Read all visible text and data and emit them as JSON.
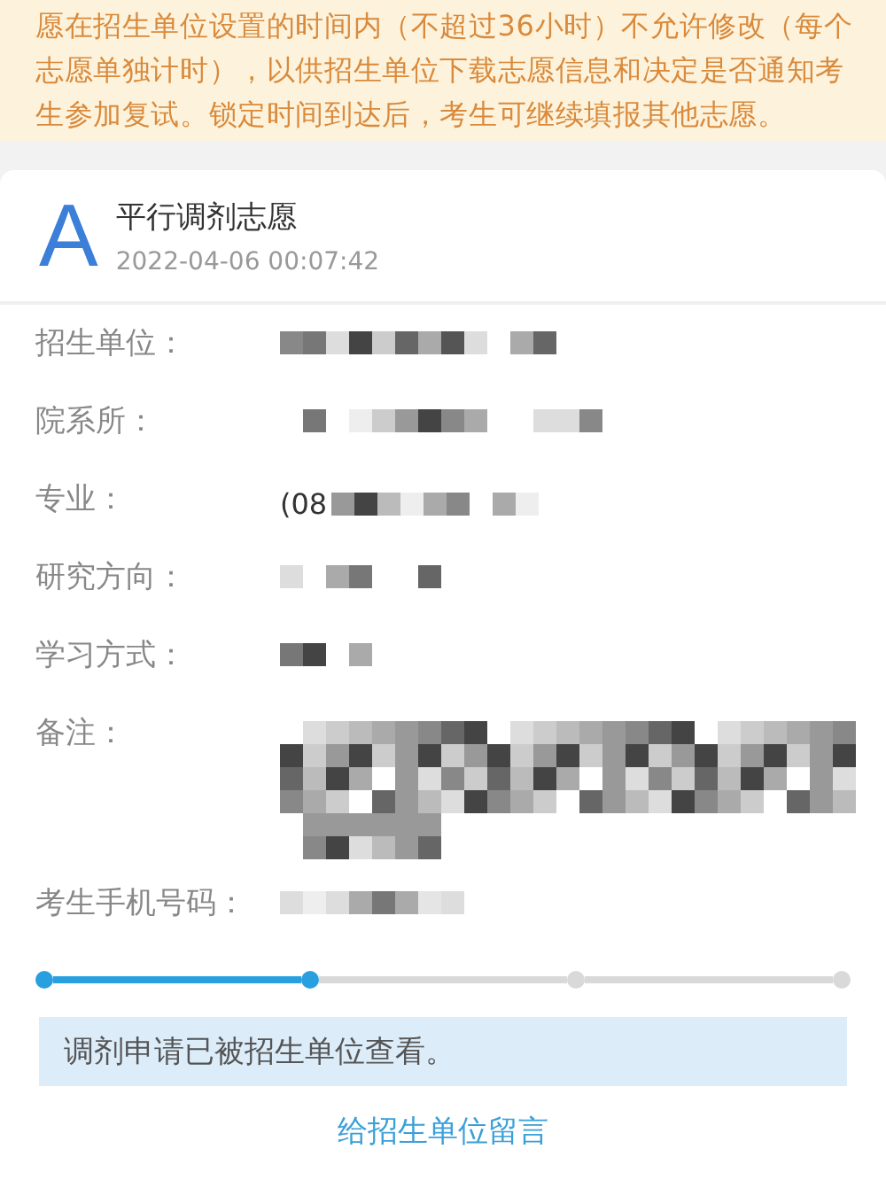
{
  "notice": {
    "lines": [
      "愿在招生单位设置的时间内（不超过36小时）不允许修改（每个",
      "志愿单独计时），以供招生单位下载志愿信息和决定是否通知考",
      "生参加复试。锁定时间到达后，考生可继续填报其他志愿。"
    ]
  },
  "card": {
    "badge": "A",
    "title": "平行调剂志愿",
    "time": "2022-04-06 00:07:42"
  },
  "fields": [
    {
      "label": "招生单位："
    },
    {
      "label": "院系所："
    },
    {
      "label": "专业：",
      "prefix": "(08"
    },
    {
      "label": "研究方向："
    },
    {
      "label": "学习方式："
    },
    {
      "label": "备注："
    },
    {
      "label": "考生手机号码："
    }
  ],
  "steps": [
    {
      "done": true
    },
    {
      "done": true
    },
    {
      "done": false
    },
    {
      "done": false
    }
  ],
  "status": "调剂申请已被招生单位查看。",
  "link": "给招生单位留言"
}
